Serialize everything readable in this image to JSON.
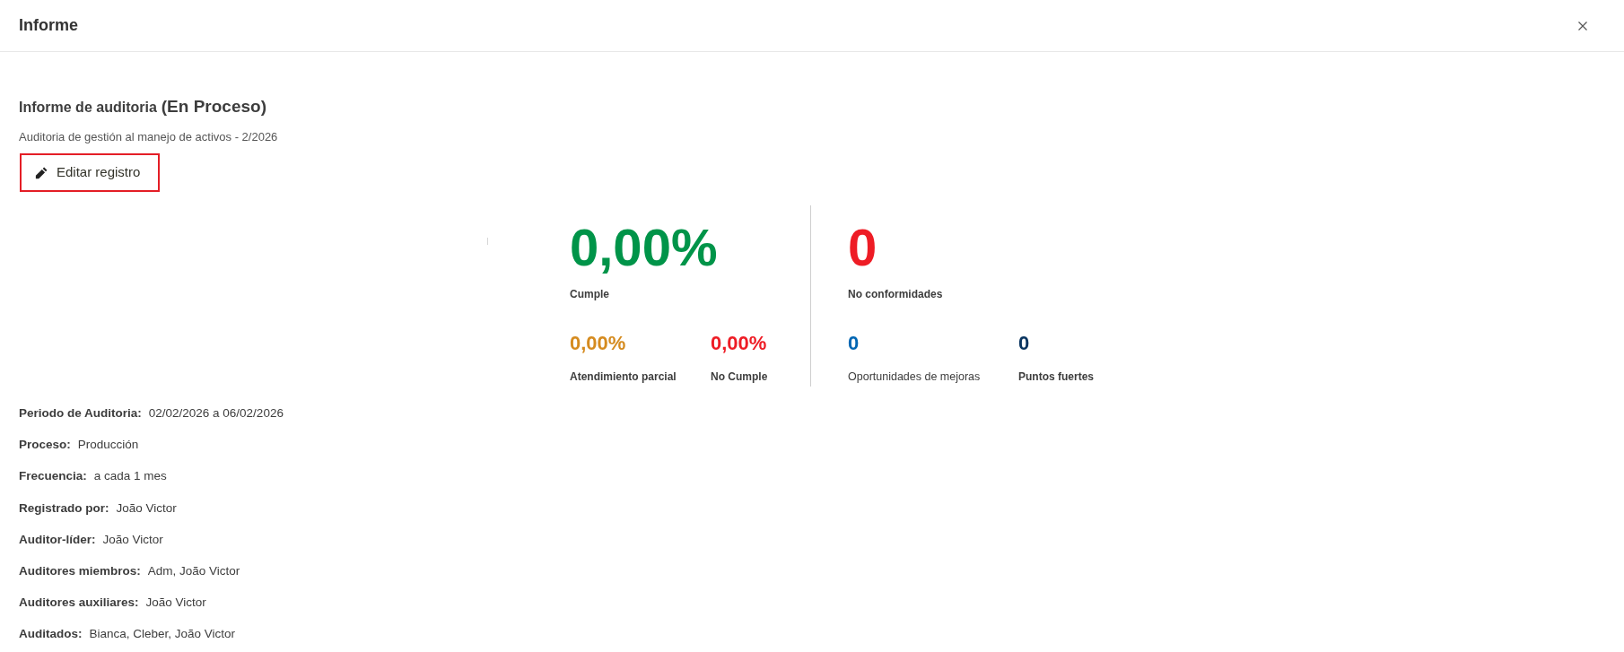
{
  "header": {
    "title": "Informe"
  },
  "report": {
    "title": "Informe de auditoria",
    "status": "(En Proceso)",
    "subtitle": "Auditoria de gestión al manejo de activos - 2/2026"
  },
  "edit_button": {
    "label": "Editar registro",
    "focused": true
  },
  "stat_groups": [
    {
      "main": {
        "value": "0,00%",
        "label": "Cumple",
        "color": "#009449"
      },
      "sub": [
        {
          "value": "0,00%",
          "label": "Atendimiento parcial",
          "color": "#d58b1f",
          "bold": true
        },
        {
          "value": "0,00%",
          "label": "No Cumple",
          "color": "#ee1c25",
          "bold": true
        }
      ]
    },
    {
      "main": {
        "value": "0",
        "label": "No conformidades",
        "color": "#ee1c25"
      },
      "sub": [
        {
          "value": "0",
          "label": "Oportunidades de mejoras",
          "color": "#0066b3",
          "bold": false
        },
        {
          "value": "0",
          "label": "Puntos fuertes",
          "color": "#0a3560",
          "bold": true
        }
      ]
    }
  ],
  "details": [
    {
      "label": "Periodo de Auditoria:",
      "value": "02/02/2026 a 06/02/2026"
    },
    {
      "label": "Proceso:",
      "value": "Producción"
    },
    {
      "label": "Frecuencia:",
      "value": "a cada 1 mes"
    },
    {
      "label": "Registrado por:",
      "value": "João Victor"
    },
    {
      "label": "Auditor-líder:",
      "value": "João Victor"
    },
    {
      "label": "Auditores miembros:",
      "value": "Adm, João Victor"
    },
    {
      "label": "Auditores auxiliares:",
      "value": "João Victor"
    },
    {
      "label": "Auditados:",
      "value": "Bianca, Cleber, João Victor"
    }
  ]
}
